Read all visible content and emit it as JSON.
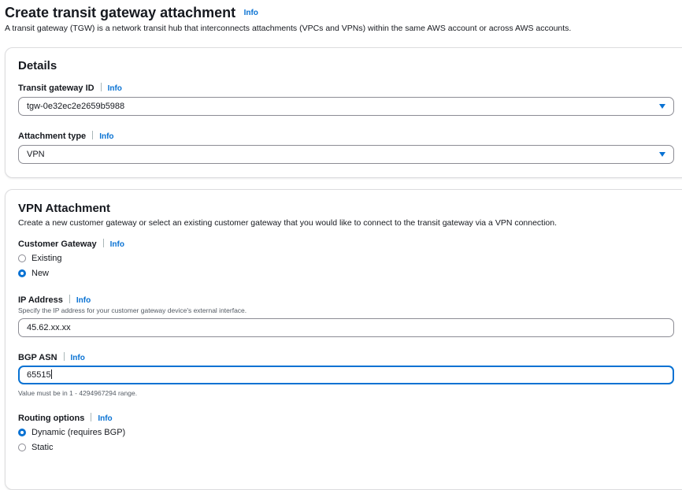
{
  "header": {
    "title": "Create transit gateway attachment",
    "info": "Info",
    "description": "A transit gateway (TGW) is a network transit hub that interconnects attachments (VPCs and VPNs) within the same AWS account or across AWS accounts."
  },
  "details": {
    "title": "Details",
    "tgw_label": "Transit gateway ID",
    "tgw_info": "Info",
    "tgw_value": "tgw-0e32ec2e2659b5988",
    "type_label": "Attachment type",
    "type_info": "Info",
    "type_value": "VPN"
  },
  "vpn": {
    "title": "VPN Attachment",
    "description": "Create a new customer gateway or select an existing customer gateway that you would like to connect to the transit gateway via a VPN connection.",
    "cgw_label": "Customer Gateway",
    "cgw_info": "Info",
    "cgw_options": [
      "Existing",
      "New"
    ],
    "cgw_selected": "New",
    "ip_label": "IP Address",
    "ip_info": "Info",
    "ip_description": "Specify the IP address for your customer gateway device's external interface.",
    "ip_value": "45.62.xx.xx",
    "asn_label": "BGP ASN",
    "asn_info": "Info",
    "asn_value": "65515",
    "asn_constraint": "Value must be in 1 - 4294967294 range.",
    "routing_label": "Routing options",
    "routing_info": "Info",
    "routing_options": [
      "Dynamic (requires BGP)",
      "Static"
    ],
    "routing_selected": "Dynamic (requires BGP)"
  },
  "colors": {
    "accent": "#0972d3",
    "text": "#16191f",
    "border": "#8c8c94"
  }
}
